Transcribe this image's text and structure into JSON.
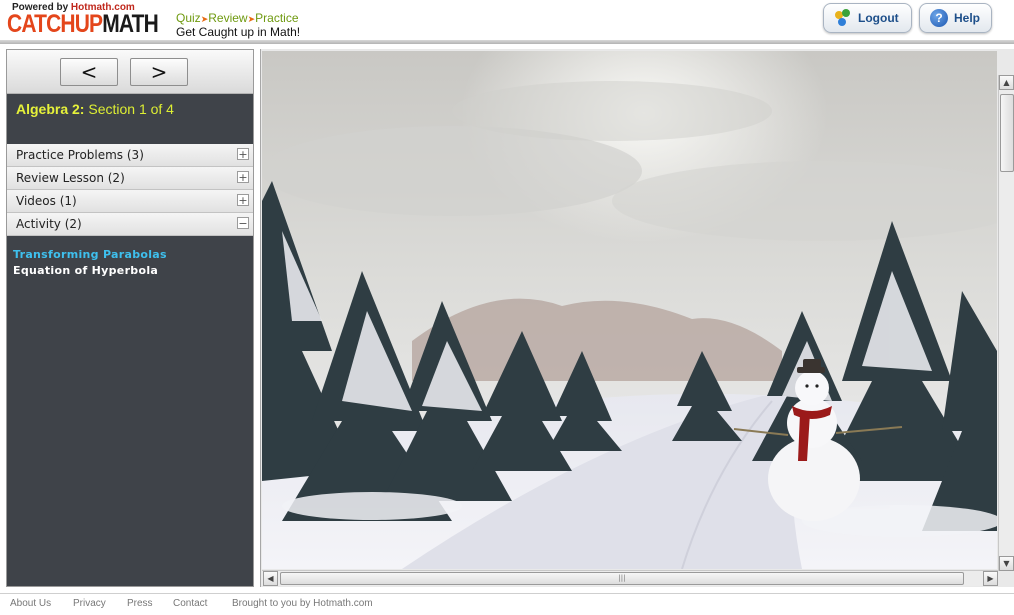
{
  "header": {
    "powered_prefix": "Powered by",
    "powered_brand": "Hotmath.com",
    "logo_part1": "CATCHUP",
    "logo_part2": "MATH",
    "tag_quiz": "Quiz",
    "tag_review": "Review",
    "tag_practice": "Practice",
    "tagline": "Get Caught up in Math!",
    "logout_label": "Logout",
    "help_label": "Help",
    "logout_icon": "people-icon",
    "help_icon": "help-icon"
  },
  "nav": {
    "prev_label": "<",
    "next_label": ">"
  },
  "section": {
    "course": "Algebra 2:",
    "section_text": "Section 1 of 4"
  },
  "accordion": [
    {
      "label": "Practice Problems (3)",
      "toggle": "+"
    },
    {
      "label": "Review Lesson (2)",
      "toggle": "+"
    },
    {
      "label": "Videos (1)",
      "toggle": "+"
    },
    {
      "label": "Activity (2)",
      "toggle": "−"
    }
  ],
  "activities": [
    {
      "label": "Transforming Parabolas",
      "active": true
    },
    {
      "label": "Equation of Hyperbola",
      "active": false
    }
  ],
  "content": {
    "image": "snowy-road-with-snowman"
  },
  "footer": {
    "links": [
      "About Us",
      "Privacy",
      "Press",
      "Contact",
      "Brought to you by Hotmath.com"
    ]
  },
  "colors": {
    "panel_bg": "#3f4349",
    "section_title": "#ddee33",
    "active_link": "#3ec0ee",
    "logo_orange": "#e4461b"
  }
}
